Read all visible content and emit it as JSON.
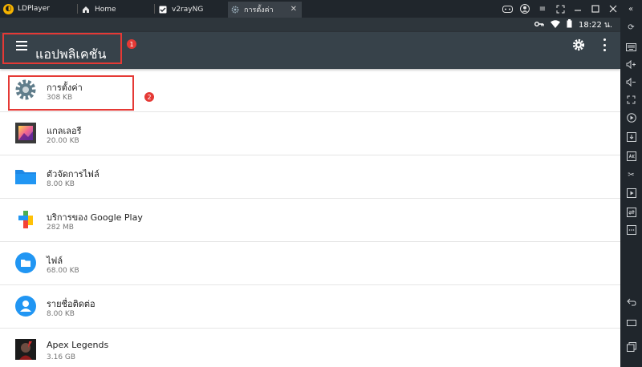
{
  "window": {
    "brand": "LDPlayer",
    "tabs": [
      {
        "label": "Home",
        "icon": "home-icon",
        "active": false
      },
      {
        "label": "v2rayNG",
        "icon": "v2rayng-icon",
        "active": false
      },
      {
        "label": "การตั้งค่า",
        "icon": "settings-gear-icon",
        "active": true
      }
    ]
  },
  "statusbar": {
    "time": "18:22 น."
  },
  "appbar": {
    "title": "แอปพลิเคชัน"
  },
  "annotations": [
    "1",
    "2"
  ],
  "apps": [
    {
      "name": "การตั้งค่า",
      "size": "308 KB",
      "icon": "settings-gear-icon"
    },
    {
      "name": "แกลเลอรี",
      "size": "20.00 KB",
      "icon": "gallery-icon"
    },
    {
      "name": "ตัวจัดการไฟล์",
      "size": "8.00 KB",
      "icon": "folder-icon"
    },
    {
      "name": "บริการของ Google Play",
      "size": "282 MB",
      "icon": "google-play-services-icon"
    },
    {
      "name": "ไฟล์",
      "size": "68.00 KB",
      "icon": "files-icon"
    },
    {
      "name": "รายชื่อติดต่อ",
      "size": "8.00 KB",
      "icon": "contacts-icon"
    },
    {
      "name": "Apex Legends",
      "size": "3.16 GB",
      "icon": "apex-legends-icon"
    }
  ],
  "colors": {
    "appbar": "#37424a",
    "statusbar": "#2e363c",
    "accent": "#e53935",
    "titlebar": "#20262c"
  }
}
